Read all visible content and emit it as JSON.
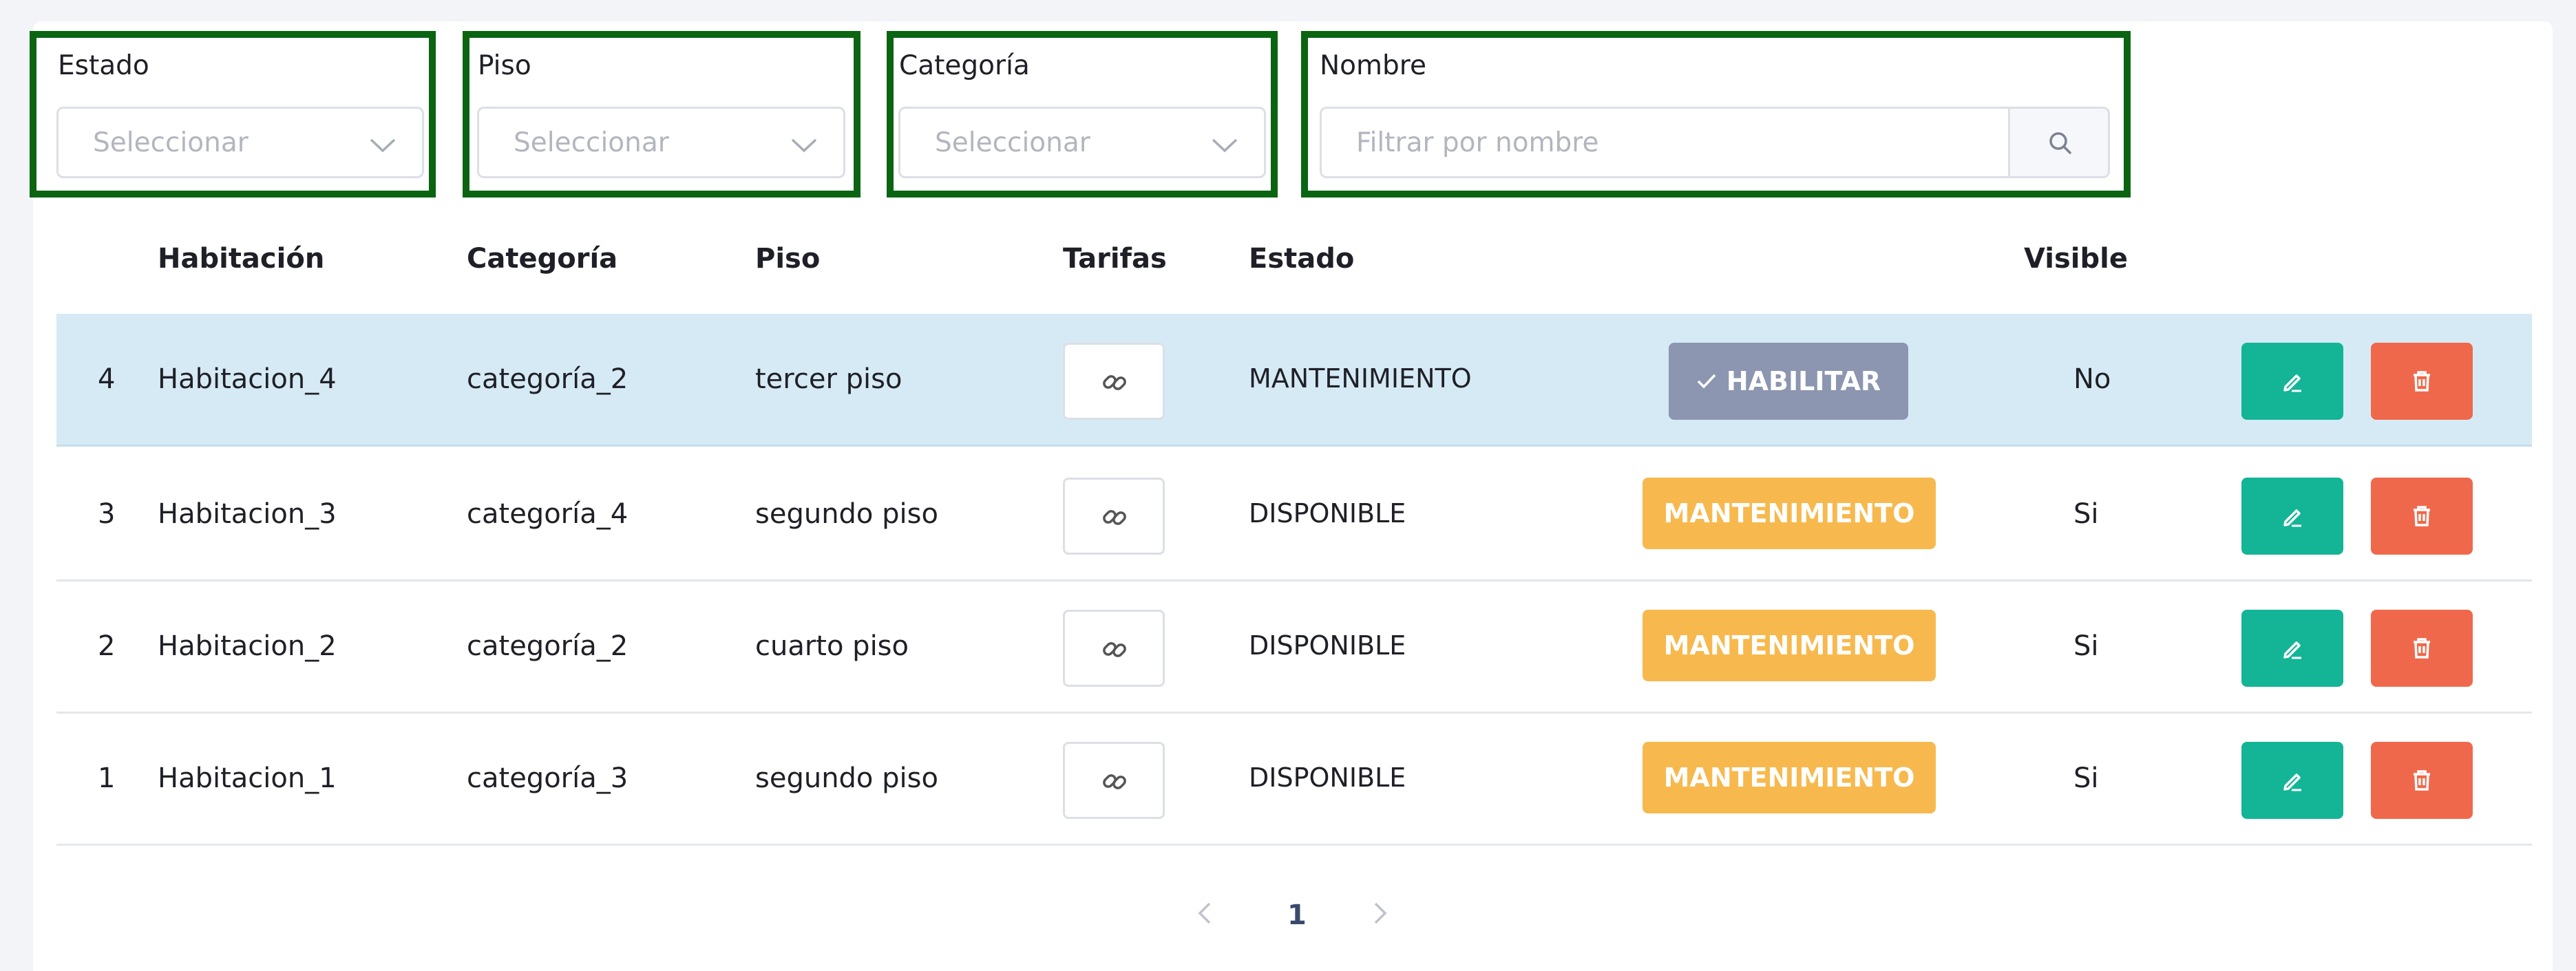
{
  "filters": {
    "estado": {
      "label": "Estado",
      "placeholder": "Seleccionar"
    },
    "piso": {
      "label": "Piso",
      "placeholder": "Seleccionar"
    },
    "categoria": {
      "label": "Categoría",
      "placeholder": "Seleccionar"
    },
    "nombre": {
      "label": "Nombre",
      "placeholder": "Filtrar por nombre"
    }
  },
  "table": {
    "headers": {
      "habitacion": "Habitación",
      "categoria": "Categoría",
      "piso": "Piso",
      "tarifas": "Tarifas",
      "estado": "Estado",
      "visible": "Visible"
    },
    "rows": [
      {
        "index": "4",
        "habitacion": "Habitacion_4",
        "categoria": "categoría_2",
        "piso": "tercer piso",
        "estado": "MANTENIMIENTO",
        "action": "HABILITAR",
        "visible": "No",
        "selected": true
      },
      {
        "index": "3",
        "habitacion": "Habitacion_3",
        "categoria": "categoría_4",
        "piso": "segundo piso",
        "estado": "DISPONIBLE",
        "action": "MANTENIMIENTO",
        "visible": "Si",
        "selected": false
      },
      {
        "index": "2",
        "habitacion": "Habitacion_2",
        "categoria": "categoría_2",
        "piso": "cuarto piso",
        "estado": "DISPONIBLE",
        "action": "MANTENIMIENTO",
        "visible": "Si",
        "selected": false
      },
      {
        "index": "1",
        "habitacion": "Habitacion_1",
        "categoria": "categoría_3",
        "piso": "segundo piso",
        "estado": "DISPONIBLE",
        "action": "MANTENIMIENTO",
        "visible": "Si",
        "selected": false
      }
    ]
  },
  "pagination": {
    "current_page": "1"
  },
  "colors": {
    "filter_highlight": "#0a6411",
    "selected_row": "#d6eaf5",
    "habilitar_button": "#8c96b0",
    "mantenimiento_button": "#f7b94d",
    "edit_button": "#13b596",
    "delete_button": "#f0684b"
  },
  "icons": {
    "select": "chevron-down-icon",
    "search": "search-icon",
    "tarifas": "link-icon",
    "habilitar": "check-icon",
    "edit": "pencil-icon",
    "delete": "trash-icon",
    "prev": "chevron-left-icon",
    "next": "chevron-right-icon"
  }
}
